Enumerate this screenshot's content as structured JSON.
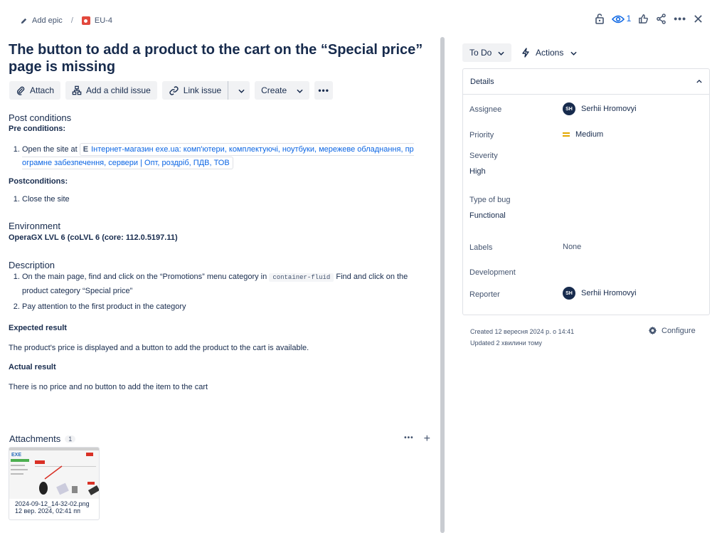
{
  "breadcrumb": {
    "epic_label": "Add epic",
    "issue_key": "EU-4"
  },
  "top_actions": {
    "watch_count": "1"
  },
  "title": "The button to add a product to the cart on the “Special price” page is missing",
  "toolbar": {
    "attach": "Attach",
    "add_child": "Add a child issue",
    "link_issue": "Link issue",
    "create": "Create"
  },
  "description": {
    "post_conditions_heading": "Post conditions",
    "pre_conditions_label": "Pre conditions:",
    "pre_item_prefix": "Open the site at",
    "pre_link_text": "Інтернет-магазин exe.ua: комп'ютери, комплектуючі, ноутбуки, мережеве обладнання, пр ограмне забезпечення, сервери | Опт, роздріб, ПДВ, ТОВ",
    "postconditions_label": "Postconditions:",
    "post_item": "Close the site",
    "environment_heading": "Environment",
    "environment_value": "OperaGX LVL 6 (coLVL 6 (core: 112.0.5197.11)",
    "description_heading": "Description",
    "step1_prefix": "On the main page, find and click on the “Promotions” menu category in",
    "step1_code": "container-fluid",
    "step1_suffix": "Find and click on the product category “Special price”",
    "step2": "Pay attention to the first product in the category",
    "expected_label": "Expected result",
    "expected_text": "The product's price is displayed and a button to add the product to the cart is available.",
    "actual_label": "Actual result",
    "actual_text": "There is no price and no button to add the item to the cart"
  },
  "attachments": {
    "heading": "Attachments",
    "count": "1",
    "file_name": "2024-09-12_14-32-02.png",
    "file_date": "12 вер. 2024, 02:41 пп"
  },
  "sidebar": {
    "status": "To Do",
    "actions": "Actions",
    "details_heading": "Details",
    "fields": {
      "assignee_label": "Assignee",
      "assignee_value": "Serhii Hromovyi",
      "assignee_initials": "SH",
      "priority_label": "Priority",
      "priority_value": "Medium",
      "severity_label": "Severity",
      "severity_value": "High",
      "bug_type_label": "Type of bug",
      "bug_type_value": "Functional",
      "labels_label": "Labels",
      "labels_value": "None",
      "development_label": "Development",
      "reporter_label": "Reporter",
      "reporter_value": "Serhii Hromovyi",
      "reporter_initials": "SH"
    },
    "created": "Created 12 вересня 2024 р. о 14:41",
    "updated": "Updated 2 хвилини тому",
    "configure": "Configure"
  },
  "colors": {
    "accent": "#0c66e4",
    "epic": "#e2483d",
    "priority": "#e2a700"
  }
}
